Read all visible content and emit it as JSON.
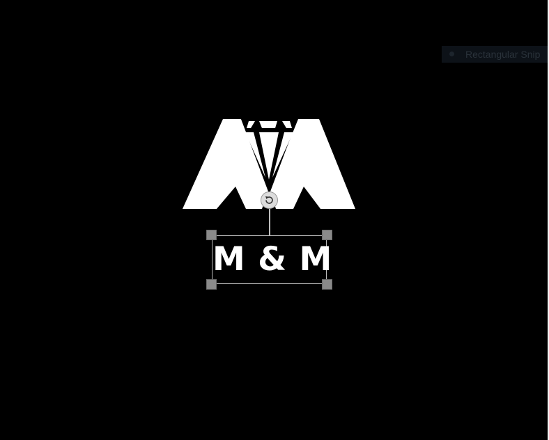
{
  "snip_tool": {
    "label": "Rectangular Snip"
  },
  "logo": {
    "brand_text": "M & M",
    "icon": "diamond-m-logo-icon"
  },
  "selection": {
    "rotate_icon": "rotate-icon"
  },
  "colors": {
    "background": "#000000",
    "logo": "#ffffff",
    "selection_border": "#bdbdbd",
    "handle": "#8a8a8a"
  }
}
